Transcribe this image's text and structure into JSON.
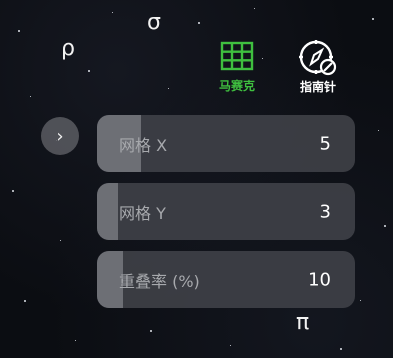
{
  "sky_labels": {
    "rho": "ρ",
    "sigma": "σ",
    "pi": "π"
  },
  "tools": [
    {
      "label": "马赛克",
      "icon": "grid-icon",
      "color": "#3fbf3f",
      "active": true
    },
    {
      "label": "指南针",
      "icon": "compass-off-icon",
      "color": "#ffffff",
      "active": false
    }
  ],
  "expand_button": {
    "icon": "chevron-right-icon",
    "glyph": "›"
  },
  "sliders": [
    {
      "label": "网格 X",
      "value": "5",
      "level": 0.17
    },
    {
      "label": "网格 Y",
      "value": "3",
      "level": 0.08
    },
    {
      "label": "重叠率 (%)",
      "value": "10",
      "level": 0.1
    }
  ],
  "colors": {
    "accent_green": "#3fbf3f",
    "slider_track": "#3e4046",
    "slider_fill": "#707278",
    "background": "#0b0d12"
  }
}
